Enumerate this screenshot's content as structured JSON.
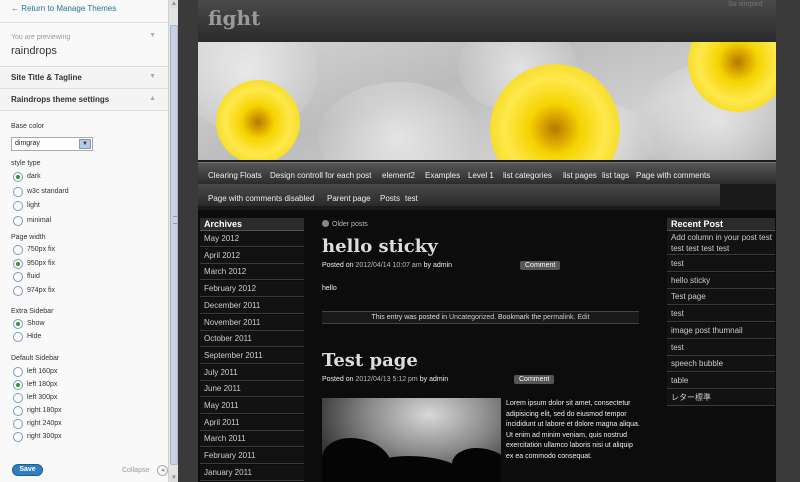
{
  "customizer": {
    "return_link": "← Return to Manage Themes",
    "previewing_label": "You are previewing",
    "theme_name": "raindrops",
    "sections": {
      "site_title": "Site Title & Tagline",
      "theme_settings": "Raindrops theme settings"
    },
    "base_color": {
      "label": "Base color",
      "value": "dimgray"
    },
    "style_type": {
      "label": "style type",
      "options": [
        {
          "label": "dark",
          "checked": true
        },
        {
          "label": "w3c standard",
          "checked": false
        },
        {
          "label": "light",
          "checked": false
        },
        {
          "label": "minimal",
          "checked": false
        }
      ]
    },
    "page_width": {
      "label": "Page width",
      "options": [
        {
          "label": "750px fix",
          "checked": false
        },
        {
          "label": "950px fix",
          "checked": true
        },
        {
          "label": "fluid",
          "checked": false
        },
        {
          "label": "974px fix",
          "checked": false
        }
      ]
    },
    "extra_sidebar": {
      "label": "Extra Sidebar",
      "options": [
        {
          "label": "Show",
          "checked": true
        },
        {
          "label": "Hide",
          "checked": false
        }
      ]
    },
    "default_sidebar": {
      "label": "Default Sidebar",
      "options": [
        {
          "label": "left 160px",
          "checked": false
        },
        {
          "label": "left 180px",
          "checked": true
        },
        {
          "label": "left 300px",
          "checked": false
        },
        {
          "label": "right 180px",
          "checked": false
        },
        {
          "label": "right 240px",
          "checked": false
        },
        {
          "label": "right 300px",
          "checked": false
        }
      ]
    },
    "save_label": "Save",
    "collapse_label": "Collapse"
  },
  "site": {
    "title": "fight",
    "tagline": "So simpled",
    "nav_row1": [
      "Clearing Floats",
      "Design controll for each post",
      "element2",
      "Examples",
      "Level 1",
      "list categories",
      "list pages",
      "list tags",
      "Page with comments"
    ],
    "nav_row2": [
      "Page with comments disabled",
      "Parent page",
      "Posts",
      "test"
    ],
    "archives": {
      "title": "Archives",
      "items": [
        "May 2012",
        "April 2012",
        "March 2012",
        "February 2012",
        "December 2011",
        "November 2011",
        "October 2011",
        "September 2011",
        "July 2011",
        "June 2011",
        "May 2011",
        "April 2011",
        "March 2011",
        "February 2011",
        "January 2011"
      ]
    },
    "recent": {
      "title": "Recent Post",
      "items": [
        "Add column in your post test test test test test",
        "test",
        "hello sticky",
        "Test page",
        "test",
        "image post thumnail",
        "test",
        "speech bubble",
        "table",
        "レター標準"
      ]
    },
    "older_posts": "Older posts",
    "post1": {
      "title": "hello sticky",
      "posted_on": "Posted on",
      "date": "2012/04/14 10:07 am",
      "by": "by",
      "author": "admin",
      "comment_label": "Comment",
      "body": "hello",
      "footer_pre": "This entry was posted in",
      "category": "Uncategorized",
      "bookmark": ". Bookmark the",
      "permalink": "permalink",
      "edit": ". Edit"
    },
    "post2": {
      "title": "Test page",
      "posted_on": "Posted on",
      "date": "2012/04/13 5:12 pm",
      "by": "by",
      "author": "admin",
      "comment_label": "Comment",
      "body": "Lorem ipsum dolor sit amet, consectetur adipisicing elit, sed do eiusmod tempor incididunt ut labore et dolore magna aliqua. Ut enim ad minim veniam, quis nostrud exercitation ullamco laboris nisi ut aliquip ex ea commodo consequat."
    }
  }
}
